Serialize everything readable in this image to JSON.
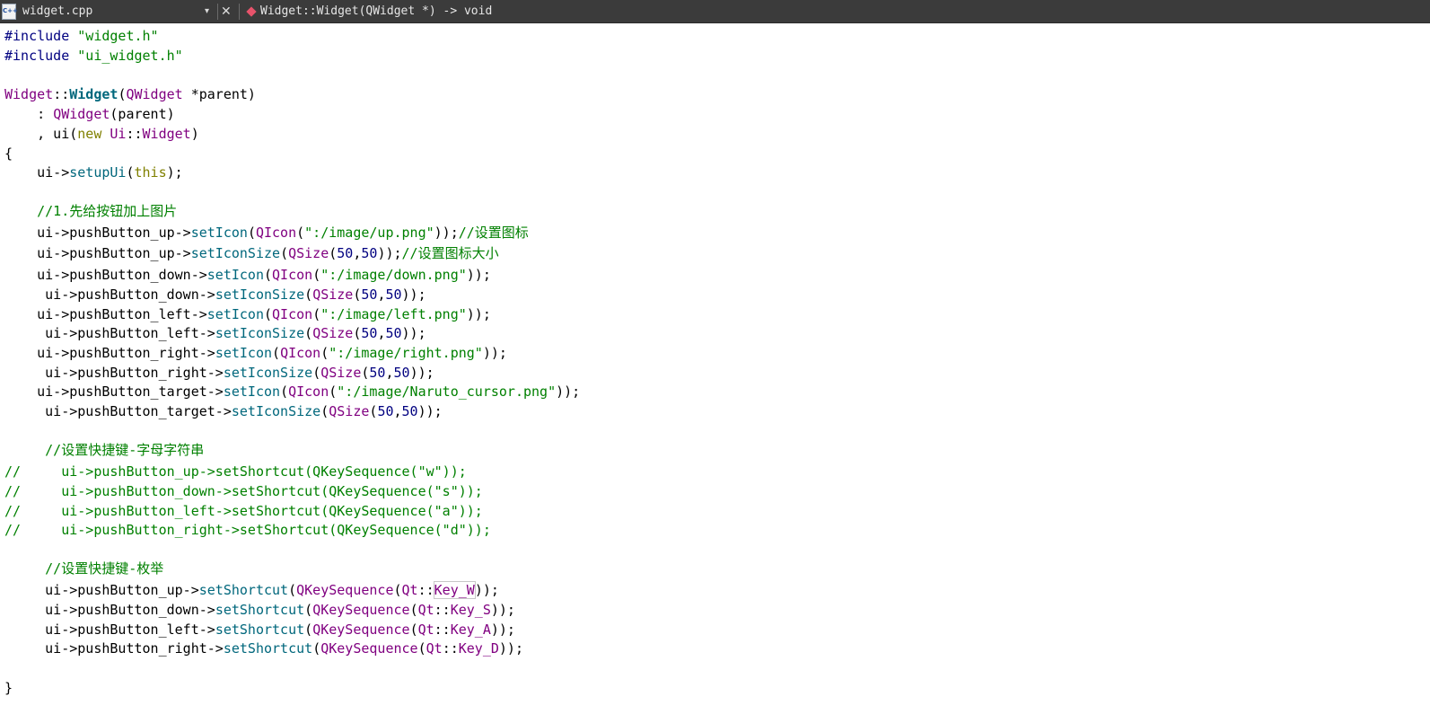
{
  "topbar": {
    "file_icon_label": "C++",
    "file_name": "widget.cpp",
    "dropdown_glyph": "▾",
    "close_glyph": "✕",
    "symbol": "Widget::Widget(QWidget *) -> void"
  },
  "code": {
    "l1": {
      "a": "#include ",
      "b": "\"widget.h\""
    },
    "l2": {
      "a": "#include ",
      "b": "\"ui_widget.h\""
    },
    "l4": {
      "a": "Widget",
      "b": "::",
      "c": "Widget",
      "d": "(",
      "e": "QWidget",
      "f": " *parent)"
    },
    "l5": {
      "a": "    : ",
      "b": "QWidget",
      "c": "(parent)"
    },
    "l6": {
      "a": "    , ui(",
      "b": "new",
      "c": " ",
      "d": "Ui",
      "e": "::",
      "f": "Widget",
      "g": ")"
    },
    "l7": {
      "a": "{"
    },
    "l8": {
      "a": "    ui->",
      "b": "setupUi",
      "c": "(",
      "d": "this",
      "e": ");"
    },
    "l10": {
      "a": "    //1.先给按钮加上图片"
    },
    "l11": {
      "a": "    ui->pushButton_up->",
      "b": "setIcon",
      "c": "(",
      "d": "QIcon",
      "e": "(",
      "f": "\":/image/up.png\"",
      "g": "));",
      "h": "//设置图标"
    },
    "l12": {
      "a": "    ui->pushButton_up->",
      "b": "setIconSize",
      "c": "(",
      "d": "QSize",
      "e": "(",
      "f": "50",
      "g": ",",
      "h": "50",
      "i": "));",
      "j": "//设置图标大小"
    },
    "l13": {
      "a": "    ui->pushButton_down->",
      "b": "setIcon",
      "c": "(",
      "d": "QIcon",
      "e": "(",
      "f": "\":/image/down.png\"",
      "g": "));"
    },
    "l14": {
      "a": "     ui->pushButton_down->",
      "b": "setIconSize",
      "c": "(",
      "d": "QSize",
      "e": "(",
      "f": "50",
      "g": ",",
      "h": "50",
      "i": "));"
    },
    "l15": {
      "a": "    ui->pushButton_left->",
      "b": "setIcon",
      "c": "(",
      "d": "QIcon",
      "e": "(",
      "f": "\":/image/left.png\"",
      "g": "));"
    },
    "l16": {
      "a": "     ui->pushButton_left->",
      "b": "setIconSize",
      "c": "(",
      "d": "QSize",
      "e": "(",
      "f": "50",
      "g": ",",
      "h": "50",
      "i": "));"
    },
    "l17": {
      "a": "    ui->pushButton_right->",
      "b": "setIcon",
      "c": "(",
      "d": "QIcon",
      "e": "(",
      "f": "\":/image/right.png\"",
      "g": "));"
    },
    "l18": {
      "a": "     ui->pushButton_right->",
      "b": "setIconSize",
      "c": "(",
      "d": "QSize",
      "e": "(",
      "f": "50",
      "g": ",",
      "h": "50",
      "i": "));"
    },
    "l19": {
      "a": "    ui->pushButton_target->",
      "b": "setIcon",
      "c": "(",
      "d": "QIcon",
      "e": "(",
      "f": "\":/image/Naruto_cursor.png\"",
      "g": "));"
    },
    "l20": {
      "a": "     ui->pushButton_target->",
      "b": "setIconSize",
      "c": "(",
      "d": "QSize",
      "e": "(",
      "f": "50",
      "g": ",",
      "h": "50",
      "i": "));"
    },
    "l22": {
      "a": "     //设置快捷键-字母字符串"
    },
    "l23": {
      "a": "//     ui->pushButton_up->setShortcut(QKeySequence(\"w\"));"
    },
    "l24": {
      "a": "//     ui->pushButton_down->setShortcut(QKeySequence(\"s\"));"
    },
    "l25": {
      "a": "//     ui->pushButton_left->setShortcut(QKeySequence(\"a\"));"
    },
    "l26": {
      "a": "//     ui->pushButton_right->setShortcut(QKeySequence(\"d\"));"
    },
    "l28": {
      "a": "     //设置快捷键-枚举"
    },
    "l29": {
      "a": "     ui->pushButton_up->",
      "b": "setShortcut",
      "c": "(",
      "d": "QKeySequence",
      "e": "(",
      "f": "Qt",
      "g": "::",
      "h": "Key_W",
      "i": "));"
    },
    "l30": {
      "a": "     ui->pushButton_down->",
      "b": "setShortcut",
      "c": "(",
      "d": "QKeySequence",
      "e": "(",
      "f": "Qt",
      "g": "::",
      "h": "Key_S",
      "i": "));"
    },
    "l31": {
      "a": "     ui->pushButton_left->",
      "b": "setShortcut",
      "c": "(",
      "d": "QKeySequence",
      "e": "(",
      "f": "Qt",
      "g": "::",
      "h": "Key_A",
      "i": "));"
    },
    "l32": {
      "a": "     ui->pushButton_right->",
      "b": "setShortcut",
      "c": "(",
      "d": "QKeySequence",
      "e": "(",
      "f": "Qt",
      "g": "::",
      "h": "Key_D",
      "i": "));"
    },
    "l34": {
      "a": "}"
    }
  }
}
